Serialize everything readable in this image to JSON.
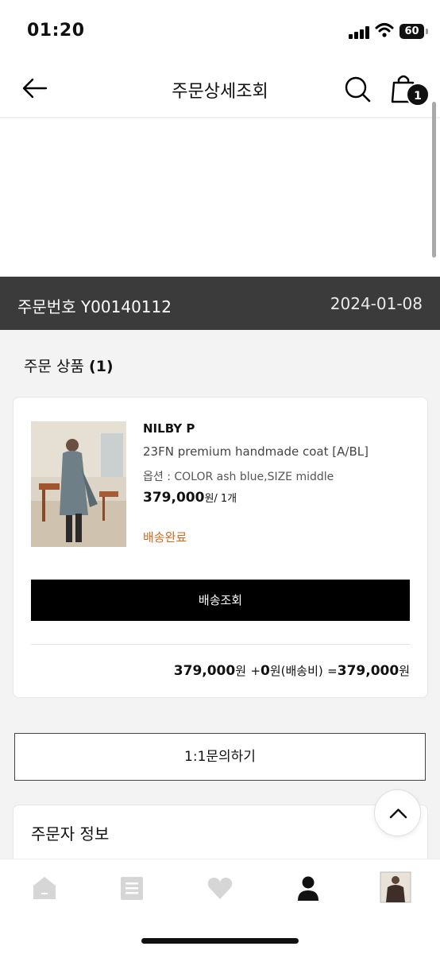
{
  "status_bar": {
    "time": "01:20",
    "battery": "60"
  },
  "header": {
    "title": "주문상세조회",
    "cart_count": "1"
  },
  "order": {
    "number_label": "주문번호",
    "number": "Y00140112",
    "date": "2024-01-08"
  },
  "section": {
    "title": "주문 상품",
    "count": "(1)"
  },
  "product": {
    "brand": "NILBY P",
    "name": "23FN premium handmade coat [A/BL]",
    "option": "옵션 : COLOR ash blue,SIZE middle",
    "price": "379,000",
    "price_unit": "원/ 1개",
    "status": "배송완료",
    "tracking_button": "배송조회"
  },
  "total": {
    "product_amount": "379,000",
    "won": "원",
    "plus": "+",
    "shipping_amount": "0",
    "shipping_label": "원(배송비)",
    "equals": "=",
    "total_amount": "379,000",
    "won_end": "원"
  },
  "inquiry_button": "1:1문의하기",
  "orderer": {
    "title": "주문자 정보"
  },
  "icons": {
    "back": "arrow-left-icon",
    "search": "search-icon",
    "cart": "shopping-bag-icon",
    "scroll_top": "chevron-up-icon",
    "nav": [
      "home-icon",
      "list-icon",
      "heart-icon",
      "person-icon",
      "profile-thumbnail"
    ]
  },
  "colors": {
    "order_bar": "#3b3b3b",
    "status": "#d2691e",
    "accent": "#000000"
  }
}
